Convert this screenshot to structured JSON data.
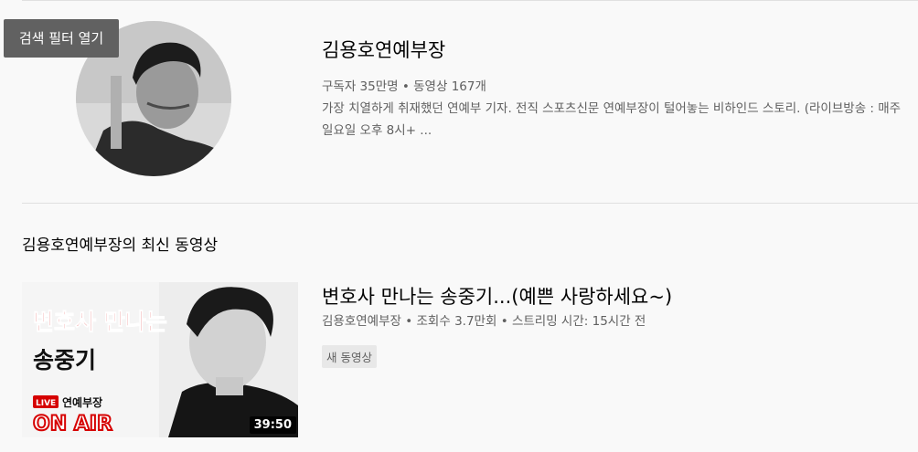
{
  "filter_tooltip": "검색 필터 열기",
  "channel": {
    "name": "김용호연예부장",
    "subscribers": "구독자 35만명",
    "separator": "•",
    "video_count": "동영상 167개",
    "description": "가장 치열하게 취재했던 연예부 기자. 전직 스포츠신문 연예부장이 털어놓는 비하인드 스토리. (라이브방송 : 매주 일요일 오후 8시+ ..."
  },
  "latest_section": {
    "title": "김용호연예부장의 최신 동영상"
  },
  "video": {
    "title": "변호사 만나는 송중기...(예쁜 사랑하세요~)",
    "channel": "김용호연예부장",
    "views": "조회수 3.7만회",
    "streamed": "스트리밍 시간: 15시간 전",
    "duration": "39:50",
    "badge": "새 동영상",
    "thumbnail_text": {
      "line1": "변호사 만나는",
      "line2": "송중기",
      "live_tag": "LIVE",
      "channel_tag": "연예부장",
      "on_air": "ON AIR"
    }
  },
  "colors": {
    "background": "#f9f9f9",
    "primary_text": "#030303",
    "secondary_text": "#606060",
    "divider": "#e0e0e0",
    "tooltip_bg": "#616161",
    "thumbnail_red": "#d60000"
  }
}
